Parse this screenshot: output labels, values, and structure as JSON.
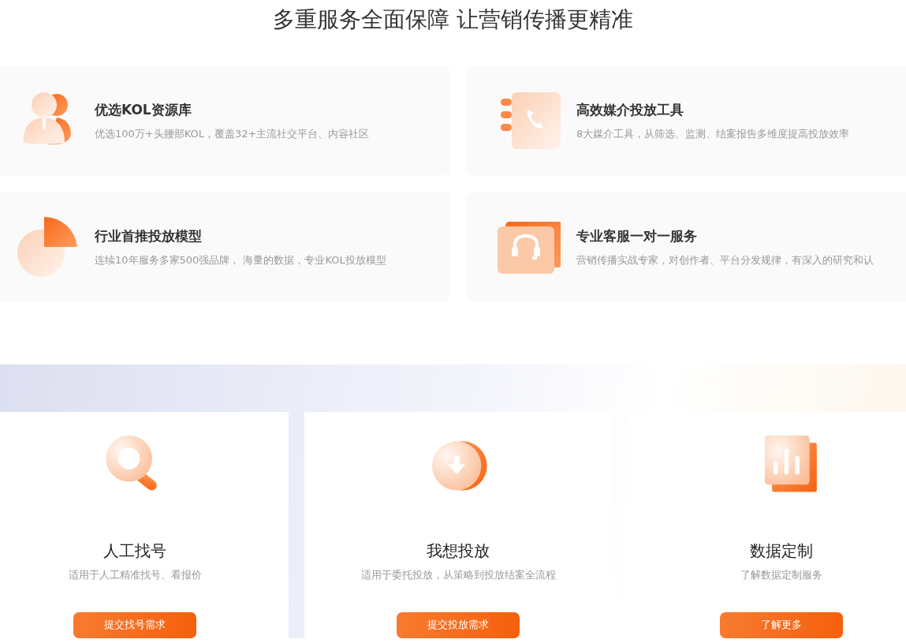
{
  "heading": "多重服务全面保障 让营销传播更精准",
  "features": [
    {
      "kind": "person",
      "title": "优选KOL资源库",
      "desc": "优选100万+头腰部KOL，覆盖32+主流社交平台、内容社区"
    },
    {
      "kind": "phone",
      "title": "高效媒介投放工具",
      "desc": "8大媒介工具，从筛选、监测、结案报告多维度提高投放效率"
    },
    {
      "kind": "pie",
      "title": "行业首推投放模型",
      "desc": "连续10年服务多家500强品牌， 海量的数据，专业KOL投放模型"
    },
    {
      "kind": "headset",
      "title": "专业客服一对一服务",
      "desc": "营销传播实战专家，对创作者、平台分发规律，有深入的研究和认"
    }
  ],
  "services": [
    {
      "kind": "search",
      "title": "人工找号",
      "desc": "适用于人工精准找号、看报价",
      "button": "提交找号需求"
    },
    {
      "kind": "download",
      "title": "我想投放",
      "desc": "适用于委托投放，从策略到投放结案全流程",
      "button": "提交投放需求"
    },
    {
      "kind": "chart",
      "title": "数据定制",
      "desc": "了解数据定制服务",
      "button": "了解更多"
    }
  ]
}
